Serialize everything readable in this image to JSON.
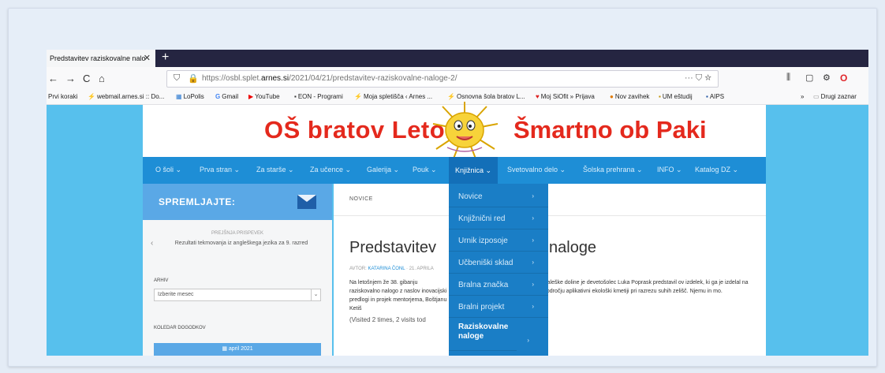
{
  "browser": {
    "tab_title": "Predstavitev raziskovalne nalo",
    "tab_close": "✕",
    "new_tab": "+",
    "url_prefix": "https://osbl.splet.",
    "url_domain": "arnes.si",
    "url_suffix": "/2021/04/21/predstavitev-raziskovalne-naloge-2/",
    "url_right": "··· ⛉ ☆",
    "nav": {
      "back": "←",
      "forward": "→",
      "reload": "C",
      "home": "⌂"
    },
    "toolbar_right": {
      "library": "⫼",
      "sidebar": "▢",
      "extension": "⚙",
      "opera": "O"
    },
    "bookmarks": [
      {
        "label": "Prvi koraki",
        "icon": ""
      },
      {
        "label": "webmail.arnes.si :: Do...",
        "icon": "⚡"
      },
      {
        "label": "LoPolis",
        "icon": "▦"
      },
      {
        "label": "Gmail",
        "icon": "G"
      },
      {
        "label": "YouTube",
        "icon": "▶"
      },
      {
        "label": "EON - Programi",
        "icon": "▪"
      },
      {
        "label": "Moja spletišča ‹ Arnes ...",
        "icon": "⚡"
      },
      {
        "label": "Osnovna šola bratov L...",
        "icon": "⚡"
      },
      {
        "label": "Moj SiOfit » Prijava",
        "icon": "♥"
      },
      {
        "label": "Nov zavihek",
        "icon": "●"
      },
      {
        "label": "UM eštudij",
        "icon": "▪"
      },
      {
        "label": "AIPS",
        "icon": "▪"
      }
    ],
    "bookmarks_overflow": "»",
    "other_bookmarks": "Drugi zaznar"
  },
  "site": {
    "title_left": "OŠ bratov Letonja",
    "title_right": "Šmartno ob Paki",
    "menu": [
      "O šoli ⌄",
      "Prva stran ⌄",
      "Za starše ⌄",
      "Za učence ⌄",
      "Galerija ⌄",
      "Pouk ⌄",
      "Knjižnica ⌄",
      "Svetovalno delo ⌄",
      "Šolska prehrana ⌄",
      "INFO ⌄",
      "Katalog DZ ⌄"
    ],
    "active_menu_index": 6
  },
  "sidebar": {
    "heading": "SPREMLJAJTE:",
    "prev_label": "PREJŠNJA PRISPEVEK",
    "prev_arrow": "‹",
    "prev_title": "Rezultati tekmovanja iz angleškega jezika za 9. razred",
    "archive_label": "ARHIV",
    "archive_select": "Izberite mesec",
    "archive_arrow": "⌄",
    "calendar_label": "KOLEDAR DOGODKOV",
    "calendar_month": "april 2021"
  },
  "content": {
    "breadcrumb": "NOVICE",
    "title_start": "Predstavitev",
    "title_end": "naloge",
    "meta_prefix": "AVTOR: ",
    "meta_author": "KATARINA ČONL",
    "meta_date": " · 21. APRILA",
    "body_left": "Na letošnjem  že 38. gibanju raziskovalno nalogo z naslov inovacijski predlogi in projek mentorjema, Boštjanu Ketiš",
    "body_right": "Šaleške doline je devetošolec Luka  Poprask predstavil ov izdelek, ki ga je izdelal na področju aplikativni ekološki kmetiji pri razrezu suhih zelišč. Njemu in mo.",
    "visited": "(Visited 2 times, 2 visits tod"
  },
  "dropdown": {
    "items": [
      "Novice",
      "Knjižnični red",
      "Urnik izposoje",
      "Učbeniški sklad",
      "Bralna značka",
      "Bralni projekt",
      "Raziskovalne naloge"
    ],
    "arrow": "›"
  },
  "colors": {
    "accent": "#1e8ed6",
    "page_bg": "#57c0ed",
    "title_red": "#e4291d"
  }
}
